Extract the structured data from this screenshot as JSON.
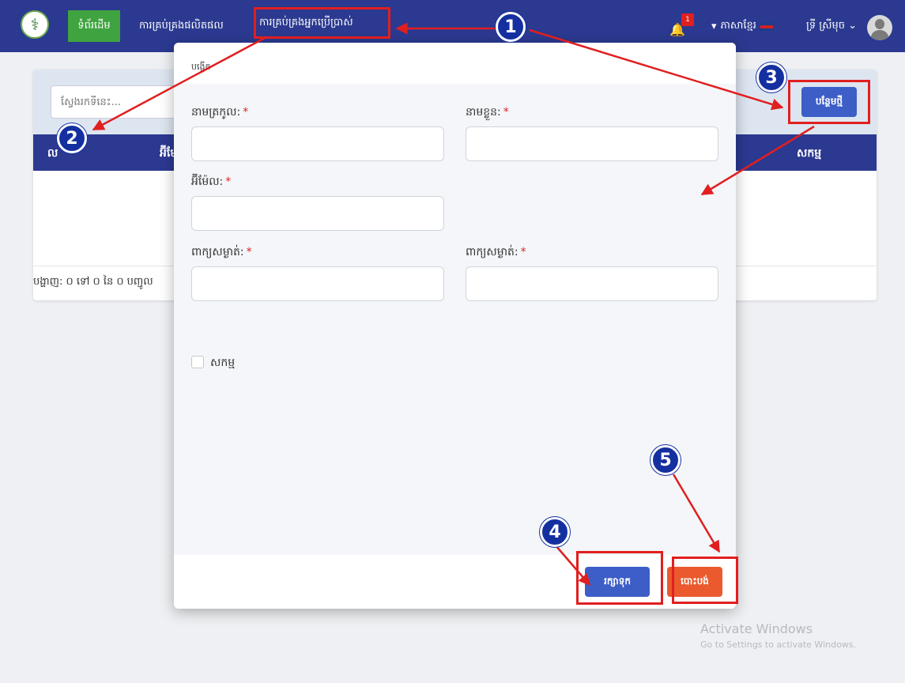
{
  "nav": {
    "logo_glyph": "⚕",
    "home": "ទំព័រដើម",
    "products": "ការគ្រប់គ្រងផលិតផល",
    "users": "ការគ្រប់គ្រងអ្នកប្រើប្រាស់",
    "notification_count": "1",
    "language": "ភាសាខ្មែរ",
    "user_name": "ទ្រី ស្រីមុច"
  },
  "page": {
    "search_placeholder": "ស្វែងរកទីនេះ...",
    "add_button": "បន្ថែមថ្មី",
    "columns": [
      "ល",
      "អ៊ីមែល",
      "សកម្ម"
    ],
    "pager": "បង្ហាញ: ០ ទៅ ០ នៃ ០ បញ្ជូល"
  },
  "modal": {
    "title": "បង្កើត",
    "fields": {
      "last_name": "នាមត្រកូល:",
      "first_name": "នាមខ្លួន:",
      "email": "អ៊ីម៉ែល:",
      "password": "ពាក្យសម្ងាត់:",
      "confirm_password": "ពាក្យសម្ងាត់:"
    },
    "required_mark": "*",
    "active_label": "សកម្ម",
    "save_button": "រក្សាទុក",
    "cancel_button": "បោះបង់"
  },
  "markers": [
    "1",
    "2",
    "3",
    "4",
    "5"
  ],
  "annotation_color": "#e01f1f",
  "watermark": {
    "line1": "Activate Windows",
    "line2": "Go to Settings to activate Windows."
  }
}
